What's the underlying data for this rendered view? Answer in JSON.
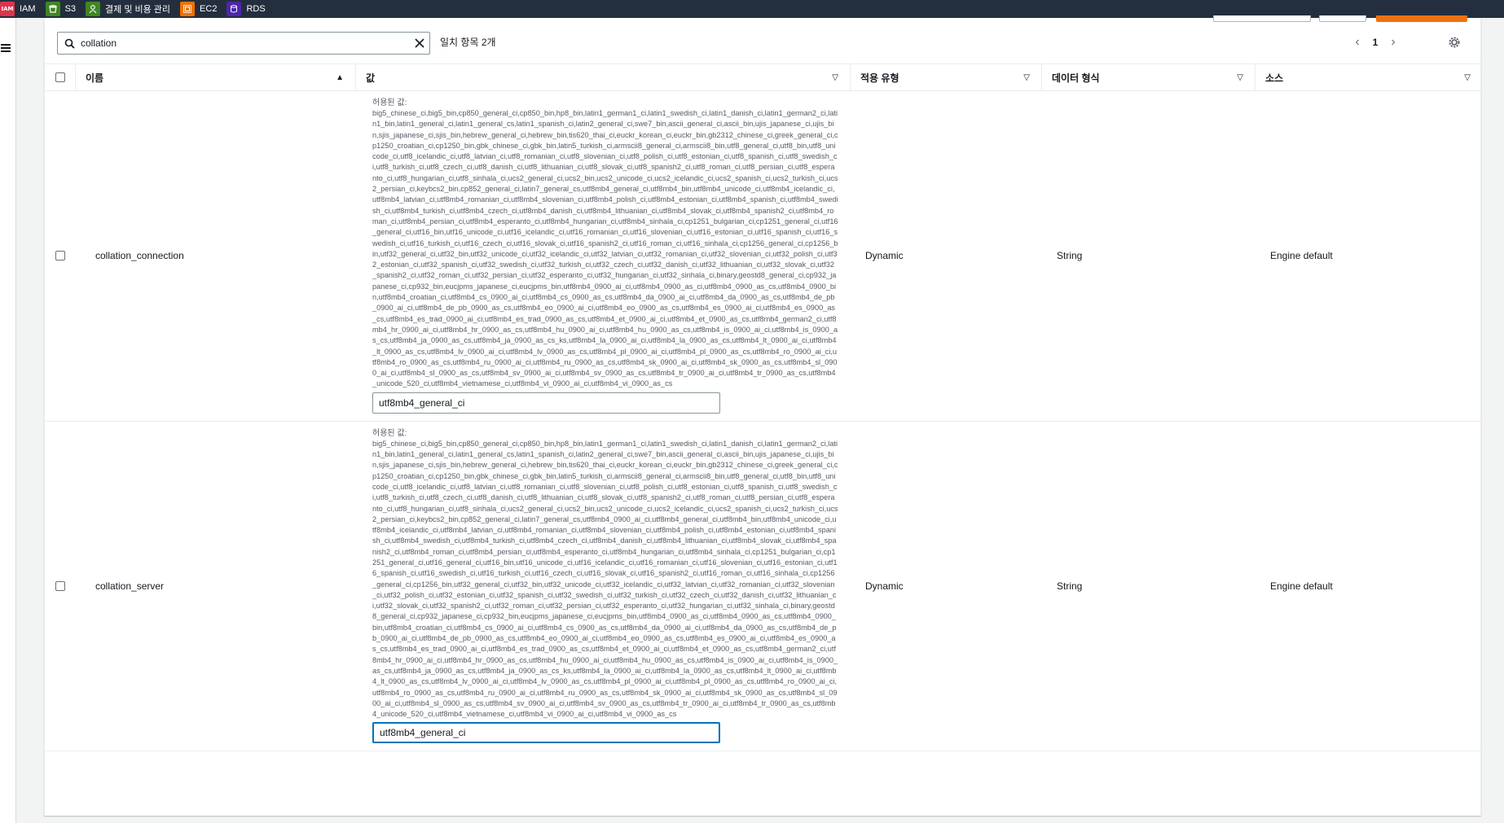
{
  "favorites": [
    {
      "label": "IAM",
      "icon": "iam-icon",
      "color": "#dd344c",
      "glyph": "IAM"
    },
    {
      "label": "S3",
      "icon": "s3-icon",
      "color": "#3f8624",
      "glyph": "S3"
    },
    {
      "label": "결제 및 비용 관리",
      "icon": "billing-icon",
      "color": "#3f8624",
      "glyph": "$"
    },
    {
      "label": "EC2",
      "icon": "ec2-icon",
      "color": "#ed7100",
      "glyph": "EC2"
    },
    {
      "label": "RDS",
      "icon": "rds-icon",
      "color": "#4d27aa",
      "glyph": "DB"
    }
  ],
  "search": {
    "value": "collation",
    "placeholder": ""
  },
  "match_text": "일치 항목 2개",
  "pagination": {
    "current": "1"
  },
  "columns": {
    "name": "이름",
    "value": "값",
    "apply_type": "적용 유형",
    "data_type": "데이터 형식",
    "source": "소스"
  },
  "rows": [
    {
      "name": "collation_connection",
      "allowed_label": "허용된 값:",
      "allowed_values": "big5_chinese_ci,big5_bin,cp850_general_ci,cp850_bin,hp8_bin,latin1_german1_ci,latin1_swedish_ci,latin1_danish_ci,latin1_german2_ci,latin1_bin,latin1_general_ci,latin1_general_cs,latin1_spanish_ci,latin2_general_ci,swe7_bin,ascii_general_ci,ascii_bin,ujis_japanese_ci,ujis_bin,sjis_japanese_ci,sjis_bin,hebrew_general_ci,hebrew_bin,tis620_thai_ci,euckr_korean_ci,euckr_bin,gb2312_chinese_ci,greek_general_ci,cp1250_croatian_ci,cp1250_bin,gbk_chinese_ci,gbk_bin,latin5_turkish_ci,armscii8_general_ci,armscii8_bin,utf8_general_ci,utf8_bin,utf8_unicode_ci,utf8_icelandic_ci,utf8_latvian_ci,utf8_romanian_ci,utf8_slovenian_ci,utf8_polish_ci,utf8_estonian_ci,utf8_spanish_ci,utf8_swedish_ci,utf8_turkish_ci,utf8_czech_ci,utf8_danish_ci,utf8_lithuanian_ci,utf8_slovak_ci,utf8_spanish2_ci,utf8_roman_ci,utf8_persian_ci,utf8_esperanto_ci,utf8_hungarian_ci,utf8_sinhala_ci,ucs2_general_ci,ucs2_bin,ucs2_unicode_ci,ucs2_icelandic_ci,ucs2_spanish_ci,ucs2_turkish_ci,ucs2_persian_ci,keybcs2_bin,cp852_general_ci,latin7_general_cs,utf8mb4_general_ci,utf8mb4_bin,utf8mb4_unicode_ci,utf8mb4_icelandic_ci,utf8mb4_latvian_ci,utf8mb4_romanian_ci,utf8mb4_slovenian_ci,utf8mb4_polish_ci,utf8mb4_estonian_ci,utf8mb4_spanish_ci,utf8mb4_swedish_ci,utf8mb4_turkish_ci,utf8mb4_czech_ci,utf8mb4_danish_ci,utf8mb4_lithuanian_ci,utf8mb4_slovak_ci,utf8mb4_spanish2_ci,utf8mb4_roman_ci,utf8mb4_persian_ci,utf8mb4_esperanto_ci,utf8mb4_hungarian_ci,utf8mb4_sinhala_ci,cp1251_bulgarian_ci,cp1251_general_ci,utf16_general_ci,utf16_bin,utf16_unicode_ci,utf16_icelandic_ci,utf16_romanian_ci,utf16_slovenian_ci,utf16_estonian_ci,utf16_spanish_ci,utf16_swedish_ci,utf16_turkish_ci,utf16_czech_ci,utf16_slovak_ci,utf16_spanish2_ci,utf16_roman_ci,utf16_sinhala_ci,cp1256_general_ci,cp1256_bin,utf32_general_ci,utf32_bin,utf32_unicode_ci,utf32_icelandic_ci,utf32_latvian_ci,utf32_romanian_ci,utf32_slovenian_ci,utf32_polish_ci,utf32_estonian_ci,utf32_spanish_ci,utf32_swedish_ci,utf32_turkish_ci,utf32_czech_ci,utf32_danish_ci,utf32_lithuanian_ci,utf32_slovak_ci,utf32_spanish2_ci,utf32_roman_ci,utf32_persian_ci,utf32_esperanto_ci,utf32_hungarian_ci,utf32_sinhala_ci,binary,geostd8_general_ci,cp932_japanese_ci,cp932_bin,eucjpms_japanese_ci,eucjpms_bin,utf8mb4_0900_ai_ci,utf8mb4_0900_as_ci,utf8mb4_0900_as_cs,utf8mb4_0900_bin,utf8mb4_croatian_ci,utf8mb4_cs_0900_ai_ci,utf8mb4_cs_0900_as_cs,utf8mb4_da_0900_ai_ci,utf8mb4_da_0900_as_cs,utf8mb4_de_pb_0900_ai_ci,utf8mb4_de_pb_0900_as_cs,utf8mb4_eo_0900_ai_ci,utf8mb4_eo_0900_as_cs,utf8mb4_es_0900_ai_ci,utf8mb4_es_0900_as_cs,utf8mb4_es_trad_0900_ai_ci,utf8mb4_es_trad_0900_as_cs,utf8mb4_et_0900_ai_ci,utf8mb4_et_0900_as_cs,utf8mb4_german2_ci,utf8mb4_hr_0900_ai_ci,utf8mb4_hr_0900_as_cs,utf8mb4_hu_0900_ai_ci,utf8mb4_hu_0900_as_cs,utf8mb4_is_0900_ai_ci,utf8mb4_is_0900_as_cs,utf8mb4_ja_0900_as_cs,utf8mb4_ja_0900_as_cs_ks,utf8mb4_la_0900_ai_ci,utf8mb4_la_0900_as_cs,utf8mb4_lt_0900_ai_ci,utf8mb4_lt_0900_as_cs,utf8mb4_lv_0900_ai_ci,utf8mb4_lv_0900_as_cs,utf8mb4_pl_0900_ai_ci,utf8mb4_pl_0900_as_cs,utf8mb4_ro_0900_ai_ci,utf8mb4_ro_0900_as_cs,utf8mb4_ru_0900_ai_ci,utf8mb4_ru_0900_as_cs,utf8mb4_sk_0900_ai_ci,utf8mb4_sk_0900_as_cs,utf8mb4_sl_0900_ai_ci,utf8mb4_sl_0900_as_cs,utf8mb4_sv_0900_ai_ci,utf8mb4_sv_0900_as_cs,utf8mb4_tr_0900_ai_ci,utf8mb4_tr_0900_as_cs,utf8mb4_unicode_520_ci,utf8mb4_vietnamese_ci,utf8mb4_vi_0900_ai_ci,utf8mb4_vi_0900_as_cs",
      "value": "utf8mb4_general_ci",
      "apply_type": "Dynamic",
      "data_type": "String",
      "source": "Engine default"
    },
    {
      "name": "collation_server",
      "allowed_label": "허용된 값:",
      "allowed_values": "big5_chinese_ci,big5_bin,cp850_general_ci,cp850_bin,hp8_bin,latin1_german1_ci,latin1_swedish_ci,latin1_danish_ci,latin1_german2_ci,latin1_bin,latin1_general_ci,latin1_general_cs,latin1_spanish_ci,latin2_general_ci,swe7_bin,ascii_general_ci,ascii_bin,ujis_japanese_ci,ujis_bin,sjis_japanese_ci,sjis_bin,hebrew_general_ci,hebrew_bin,tis620_thai_ci,euckr_korean_ci,euckr_bin,gb2312_chinese_ci,greek_general_ci,cp1250_croatian_ci,cp1250_bin,gbk_chinese_ci,gbk_bin,latin5_turkish_ci,armscii8_general_ci,armscii8_bin,utf8_general_ci,utf8_bin,utf8_unicode_ci,utf8_icelandic_ci,utf8_latvian_ci,utf8_romanian_ci,utf8_slovenian_ci,utf8_polish_ci,utf8_estonian_ci,utf8_spanish_ci,utf8_swedish_ci,utf8_turkish_ci,utf8_czech_ci,utf8_danish_ci,utf8_lithuanian_ci,utf8_slovak_ci,utf8_spanish2_ci,utf8_roman_ci,utf8_persian_ci,utf8_esperanto_ci,utf8_hungarian_ci,utf8_sinhala_ci,ucs2_general_ci,ucs2_bin,ucs2_unicode_ci,ucs2_icelandic_ci,ucs2_spanish_ci,ucs2_turkish_ci,ucs2_persian_ci,keybcs2_bin,cp852_general_ci,latin7_general_cs,utf8mb4_0900_ai_ci,utf8mb4_general_ci,utf8mb4_bin,utf8mb4_unicode_ci,utf8mb4_icelandic_ci,utf8mb4_latvian_ci,utf8mb4_romanian_ci,utf8mb4_slovenian_ci,utf8mb4_polish_ci,utf8mb4_estonian_ci,utf8mb4_spanish_ci,utf8mb4_swedish_ci,utf8mb4_turkish_ci,utf8mb4_czech_ci,utf8mb4_danish_ci,utf8mb4_lithuanian_ci,utf8mb4_slovak_ci,utf8mb4_spanish2_ci,utf8mb4_roman_ci,utf8mb4_persian_ci,utf8mb4_esperanto_ci,utf8mb4_hungarian_ci,utf8mb4_sinhala_ci,cp1251_bulgarian_ci,cp1251_general_ci,utf16_general_ci,utf16_bin,utf16_unicode_ci,utf16_icelandic_ci,utf16_romanian_ci,utf16_slovenian_ci,utf16_estonian_ci,utf16_spanish_ci,utf16_swedish_ci,utf16_turkish_ci,utf16_czech_ci,utf16_slovak_ci,utf16_spanish2_ci,utf16_roman_ci,utf16_sinhala_ci,cp1256_general_ci,cp1256_bin,utf32_general_ci,utf32_bin,utf32_unicode_ci,utf32_icelandic_ci,utf32_latvian_ci,utf32_romanian_ci,utf32_slovenian_ci,utf32_polish_ci,utf32_estonian_ci,utf32_spanish_ci,utf32_swedish_ci,utf32_turkish_ci,utf32_czech_ci,utf32_danish_ci,utf32_lithuanian_ci,utf32_slovak_ci,utf32_spanish2_ci,utf32_roman_ci,utf32_persian_ci,utf32_esperanto_ci,utf32_hungarian_ci,utf32_sinhala_ci,binary,geostd8_general_ci,cp932_japanese_ci,cp932_bin,eucjpms_japanese_ci,eucjpms_bin,utf8mb4_0900_as_ci,utf8mb4_0900_as_cs,utf8mb4_0900_bin,utf8mb4_croatian_ci,utf8mb4_cs_0900_ai_ci,utf8mb4_cs_0900_as_cs,utf8mb4_da_0900_ai_ci,utf8mb4_da_0900_as_cs,utf8mb4_de_pb_0900_ai_ci,utf8mb4_de_pb_0900_as_cs,utf8mb4_eo_0900_ai_ci,utf8mb4_eo_0900_as_cs,utf8mb4_es_0900_ai_ci,utf8mb4_es_0900_as_cs,utf8mb4_es_trad_0900_ai_ci,utf8mb4_es_trad_0900_as_cs,utf8mb4_et_0900_ai_ci,utf8mb4_et_0900_as_cs,utf8mb4_german2_ci,utf8mb4_hr_0900_ai_ci,utf8mb4_hr_0900_as_cs,utf8mb4_hu_0900_ai_ci,utf8mb4_hu_0900_as_cs,utf8mb4_is_0900_ai_ci,utf8mb4_is_0900_as_cs,utf8mb4_ja_0900_as_cs,utf8mb4_ja_0900_as_cs_ks,utf8mb4_la_0900_ai_ci,utf8mb4_la_0900_as_cs,utf8mb4_lt_0900_ai_ci,utf8mb4_lt_0900_as_cs,utf8mb4_lv_0900_ai_ci,utf8mb4_lv_0900_as_cs,utf8mb4_pl_0900_ai_ci,utf8mb4_pl_0900_as_cs,utf8mb4_ro_0900_ai_ci,utf8mb4_ro_0900_as_cs,utf8mb4_ru_0900_ai_ci,utf8mb4_ru_0900_as_cs,utf8mb4_sk_0900_ai_ci,utf8mb4_sk_0900_as_cs,utf8mb4_sl_0900_ai_ci,utf8mb4_sl_0900_as_cs,utf8mb4_sv_0900_ai_ci,utf8mb4_sv_0900_as_cs,utf8mb4_tr_0900_ai_ci,utf8mb4_tr_0900_as_cs,utf8mb4_unicode_520_ci,utf8mb4_vietnamese_ci,utf8mb4_vi_0900_ai_ci,utf8mb4_vi_0900_as_cs",
      "value": "utf8mb4_general_ci",
      "apply_type": "Dynamic",
      "data_type": "String",
      "source": "Engine default"
    }
  ],
  "colors": {
    "favbar": "#232f3e",
    "focus": "#0073bb",
    "accent": "#ec7211"
  }
}
